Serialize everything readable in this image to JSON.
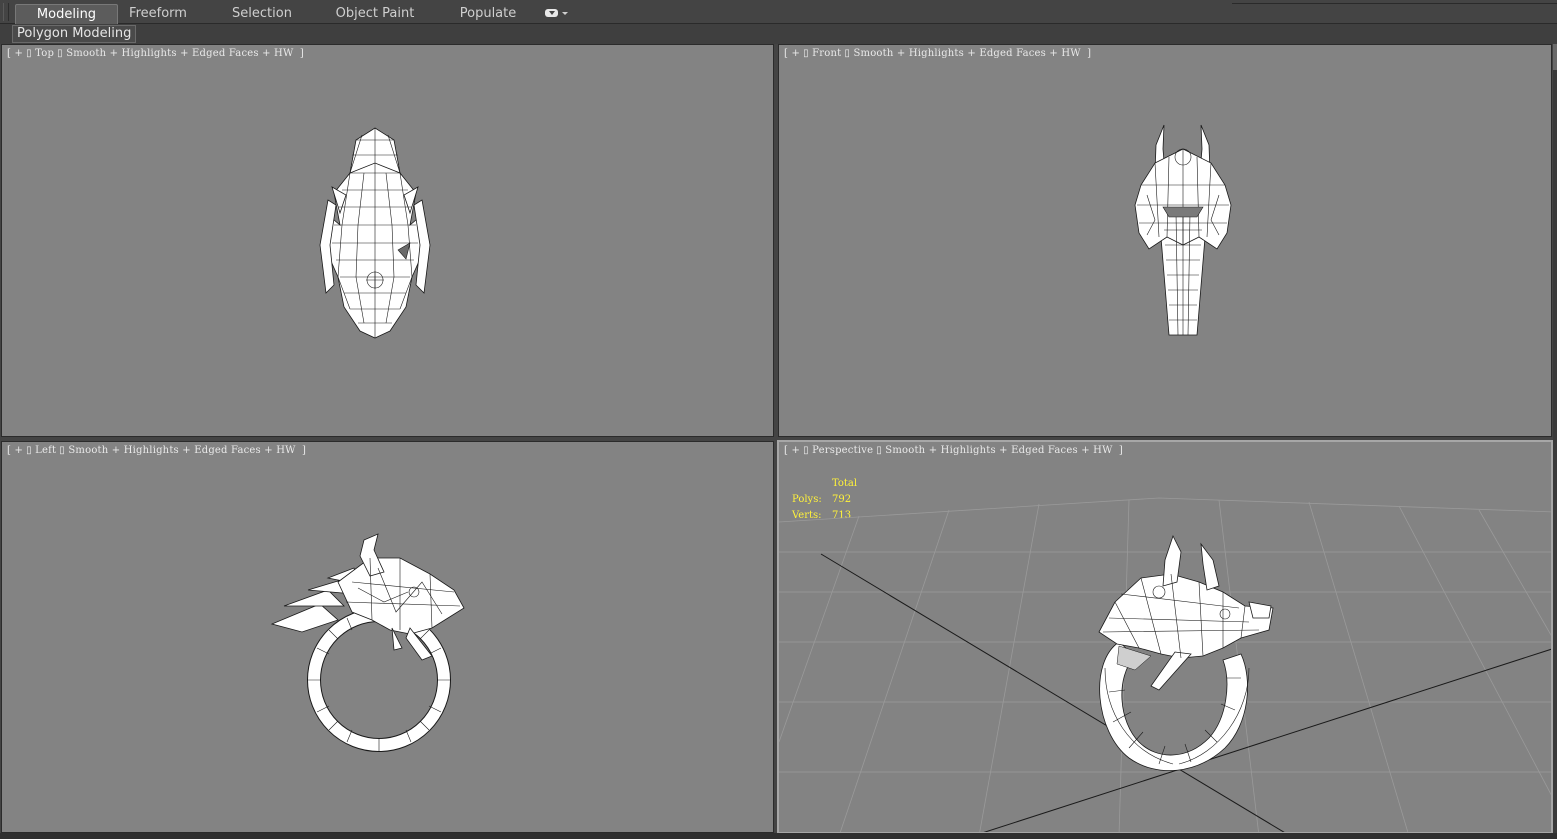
{
  "ribbon": {
    "tabs": [
      {
        "label": "Modeling",
        "active": true
      },
      {
        "label": "Freeform",
        "active": false
      },
      {
        "label": "Selection",
        "active": false
      },
      {
        "label": "Object Paint",
        "active": false
      },
      {
        "label": "Populate",
        "active": false
      }
    ],
    "menu_icon": "ribbon-display-options-icon",
    "panel_label": "Polygon Modeling"
  },
  "viewports": {
    "top": {
      "plus": "+",
      "view": "Top",
      "shading": "Smooth + Highlights + Edged Faces + HW"
    },
    "front": {
      "plus": "+",
      "view": "Front",
      "shading": "Smooth + Highlights + Edged Faces + HW"
    },
    "left": {
      "plus": "+",
      "view": "Left",
      "shading": "Smooth + Highlights + Edged Faces + HW"
    },
    "perspective": {
      "plus": "+",
      "view": "Perspective",
      "shading": "Smooth + Highlights + Edged Faces + HW"
    }
  },
  "stats": {
    "header": "Total",
    "polys_label": "Polys:",
    "polys_value": "792",
    "verts_label": "Verts:",
    "verts_value": "713"
  },
  "colors": {
    "viewport_bg": "#838383",
    "ui_bg": "#444444",
    "stats_text": "#fff23a",
    "mesh_fill": "#ffffff",
    "wire": "#1a1a1a"
  }
}
